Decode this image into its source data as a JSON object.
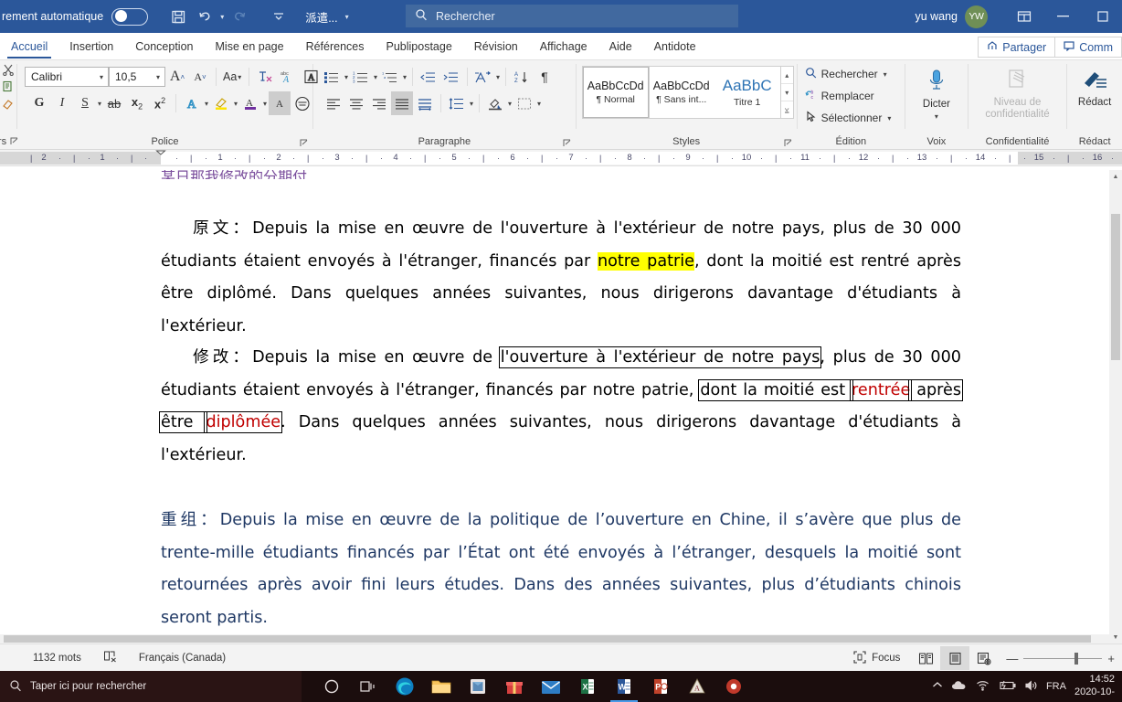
{
  "titlebar": {
    "autosave_label": "rement automatique",
    "autosave_state": "off",
    "save_icon": "save-icon",
    "undo_icon": "undo-icon",
    "redo_icon": "redo-icon",
    "customize_icon": "customize-quick-access-icon",
    "doc_name": "派遣...",
    "search_placeholder": "Rechercher",
    "search_icon": "search-icon",
    "user_name": "yu wang",
    "avatar_initials": "YW",
    "ribbon_display_icon": "ribbon-display-options-icon",
    "minimize_label": "—",
    "accent_color": "#2b579a"
  },
  "tabs": [
    {
      "label": "Accueil",
      "active": true
    },
    {
      "label": "Insertion",
      "active": false
    },
    {
      "label": "Conception",
      "active": false
    },
    {
      "label": "Mise en page",
      "active": false
    },
    {
      "label": "Références",
      "active": false
    },
    {
      "label": "Publipostage",
      "active": false
    },
    {
      "label": "Révision",
      "active": false
    },
    {
      "label": "Affichage",
      "active": false
    },
    {
      "label": "Aide",
      "active": false
    },
    {
      "label": "Antidote",
      "active": false
    }
  ],
  "tabbar_right": {
    "share_label": "Partager",
    "share_icon": "share-icon",
    "comments_label": "Comm",
    "comments_icon": "comment-icon"
  },
  "ribbon": {
    "groups": [
      {
        "name": "clipboard",
        "label": "rs"
      },
      {
        "name": "font",
        "label": "Police"
      },
      {
        "name": "paragraph",
        "label": "Paragraphe"
      },
      {
        "name": "styles",
        "label": "Styles"
      },
      {
        "name": "editing",
        "label": "Édition"
      },
      {
        "name": "voice",
        "label": "Voix"
      },
      {
        "name": "sensitivity",
        "label": "Confidentialité"
      },
      {
        "name": "editor",
        "label": "Rédact"
      }
    ],
    "font": {
      "font_family": "Calibri",
      "font_size": "10,5",
      "grow_font_icon": "grow-font-icon",
      "shrink_font_icon": "shrink-font-icon",
      "change_case_label": "Aa",
      "clear_formatting_icon": "clear-formatting-icon",
      "phonetic_guide_icon": "phonetic-guide-icon",
      "character_border_icon": "character-border-icon",
      "bold_label": "G",
      "italic_label": "I",
      "underline_label": "S",
      "strikethrough_label": "ab",
      "subscript_label": "x",
      "superscript_label": "x",
      "text_effects_icon": "text-effects-icon",
      "highlight_icon": "text-highlight-icon",
      "font_color_icon": "font-color-icon",
      "character_shading_icon": "character-shading-icon",
      "enclose_characters_icon": "enclose-characters-icon"
    },
    "paragraph": {
      "bullets_icon": "bullet-list-icon",
      "numbering_icon": "numbered-list-icon",
      "multilevel_icon": "multilevel-list-icon",
      "decrease_indent_icon": "decrease-indent-icon",
      "increase_indent_icon": "increase-indent-icon",
      "asian_layout_icon": "asian-layout-icon",
      "sort_icon": "sort-icon",
      "show_marks_icon": "show-formatting-marks-icon",
      "align_left_icon": "align-left-icon",
      "align_center_icon": "align-center-icon",
      "align_right_icon": "align-right-icon",
      "justify_icon": "justify-icon",
      "distribute_icon": "distribute-icon",
      "line_spacing_icon": "line-spacing-icon",
      "shading_icon": "shading-icon",
      "borders_icon": "borders-icon"
    },
    "styles": {
      "items": [
        {
          "sample": "AaBbCcDd",
          "name": "¶ Normal",
          "active": true
        },
        {
          "sample": "AaBbCcDd",
          "name": "¶ Sans int...",
          "active": false
        },
        {
          "sample": "AaBbC",
          "name": "Titre 1",
          "active": false
        }
      ]
    },
    "editing": {
      "find_label": "Rechercher",
      "find_icon": "search-icon",
      "replace_label": "Remplacer",
      "replace_icon": "replace-icon",
      "select_label": "Sélectionner",
      "select_icon": "select-cursor-icon"
    },
    "voice": {
      "dictate_label": "Dicter",
      "dictate_icon": "microphone-icon"
    },
    "sensitivity": {
      "label": "Niveau de confidentialité",
      "icon": "sensitivity-icon",
      "disabled": true
    },
    "editor": {
      "label": "Rédact",
      "icon": "editor-pen-icon"
    }
  },
  "ruler": {
    "left_numbers": [
      "2",
      "1"
    ],
    "right_numbers": [
      "1",
      "2",
      "3",
      "4",
      "5",
      "6",
      "7",
      "8",
      "9",
      "10",
      "11",
      "12",
      "13",
      "14",
      "15",
      "16"
    ]
  },
  "document": {
    "clipped_heading": "某日那我修改的分期付",
    "paragraphs": [
      {
        "name": "original-paragraph",
        "label": "原文：",
        "segments": [
          {
            "text": "Depuis la mise en œuvre de l'ouverture à l'extérieur de notre pays, plus de 30 000 étudiants étaient envoyés à l'étranger, financés par ",
            "style": "plain"
          },
          {
            "text": "notre patrie",
            "style": "highlight"
          },
          {
            "text": ", dont la moitié est rentré après être diplômé. Dans quelques années suivantes, nous dirigerons davantage d'étudiants à l'extérieur.",
            "style": "plain"
          }
        ]
      },
      {
        "name": "revised-paragraph",
        "label": "修改：",
        "segments": [
          {
            "text": "Depuis la mise en œuvre de ",
            "style": "plain"
          },
          {
            "text": "l'ouverture à l'extérieur de notre pays",
            "style": "boxed"
          },
          {
            "text": ", plus de 30 000 étudiants étaient envoyés à l'étranger, financés par notre patrie, ",
            "style": "plain"
          },
          {
            "text": "dont la moitié est ",
            "style": "boxed"
          },
          {
            "text": "rentrée",
            "style": "boxed-red"
          },
          {
            "text": " après être ",
            "style": "boxed"
          },
          {
            "text": "diplômée",
            "style": "boxed-red"
          },
          {
            "text": ". Dans quelques années suivantes, nous dirigerons davantage d'étudiants à l'extérieur.",
            "style": "plain"
          }
        ]
      },
      {
        "name": "rewritten-paragraph",
        "label": "重组：",
        "segments": [
          {
            "text": "Depuis la mise en œuvre de la politique de l’ouverture en Chine, il s’avère que plus de trente-mille étudiants financés par l’État ont été envoyés à l’étranger, desquels la moitié sont retournées après avoir fini leurs études. Dans des années suivantes, plus d’étudiants chinois seront partis.",
            "style": "blue"
          }
        ]
      }
    ],
    "colors": {
      "highlight": "#ffff00",
      "red_text": "#c00000",
      "blue_text": "#1f3864"
    }
  },
  "statusbar": {
    "word_count": "1132 mots",
    "proofing_icon": "proofing-errors-icon",
    "language": "Français (Canada)",
    "focus_label": "Focus",
    "focus_icon": "focus-mode-icon",
    "read_mode_icon": "read-mode-icon",
    "print_layout_icon": "print-layout-icon",
    "web_layout_icon": "web-layout-icon",
    "zoom_out_label": "—",
    "zoom_in_label": "+"
  },
  "taskbar": {
    "search_placeholder": "Taper ici pour rechercher",
    "search_icon": "taskbar-search-icon",
    "cortana_icon": "cortana-icon",
    "taskview_icon": "task-view-icon",
    "apps": [
      {
        "name": "edge-icon"
      },
      {
        "name": "file-explorer-icon"
      },
      {
        "name": "store-icon"
      },
      {
        "name": "gift-icon"
      },
      {
        "name": "mail-icon"
      },
      {
        "name": "excel-icon"
      },
      {
        "name": "word-icon"
      },
      {
        "name": "powerpoint-icon"
      },
      {
        "name": "antidote-icon"
      },
      {
        "name": "recorder-icon"
      }
    ],
    "tray": {
      "chevron_icon": "show-hidden-icons-icon",
      "onedrive_icon": "onedrive-icon",
      "network_icon": "wifi-icon",
      "battery_icon": "battery-charging-icon",
      "volume_icon": "volume-icon",
      "language": "FRA",
      "time": "14:52",
      "date": "2020-10-"
    }
  }
}
